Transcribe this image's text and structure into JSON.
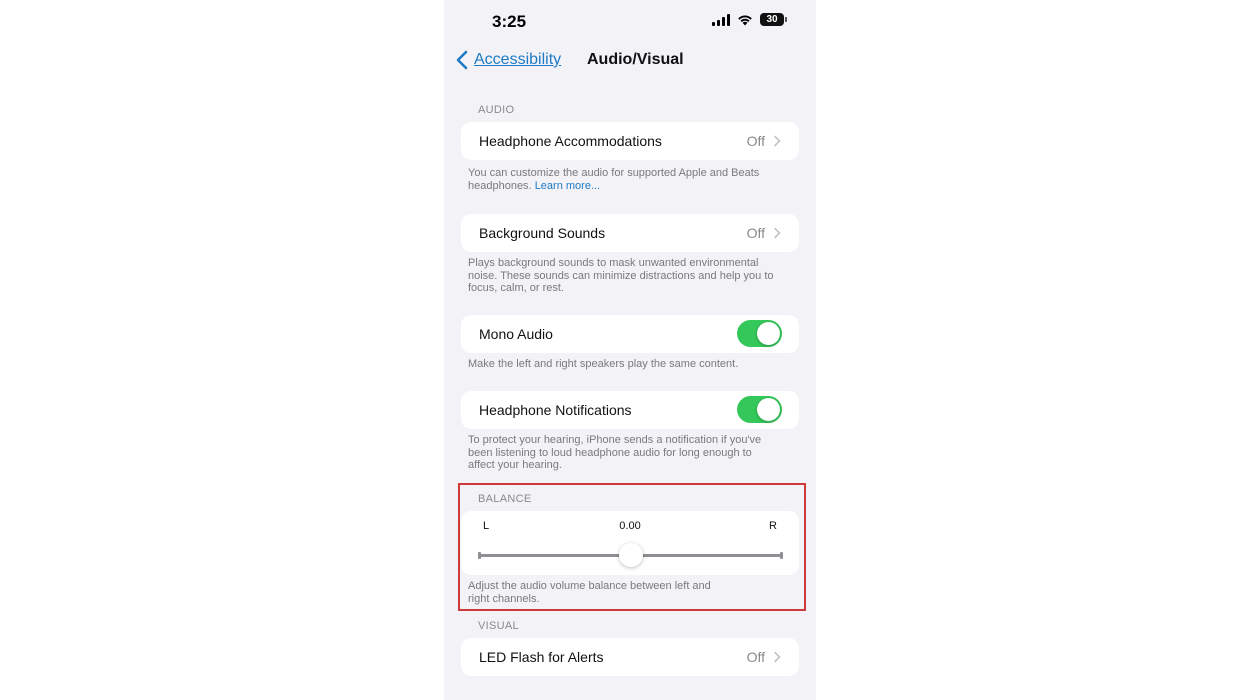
{
  "status_bar": {
    "time": "3:25",
    "battery_level": "30",
    "icons": [
      "cellular-signal-icon",
      "wifi-icon",
      "battery-icon"
    ]
  },
  "nav": {
    "back_label": "Accessibility",
    "title": "Audio/Visual"
  },
  "colors": {
    "accent": "#1f7bc4",
    "toggle_on": "#34c759",
    "background": "#f2f2f7",
    "highlight": "#d0393c"
  },
  "sections": {
    "audio": {
      "header": "AUDIO",
      "headphone_accommodations": {
        "label": "Headphone Accommodations",
        "value": "Off",
        "footer": "You can customize the audio for supported Apple and Beats headphones.",
        "footer_link": "Learn more..."
      },
      "background_sounds": {
        "label": "Background Sounds",
        "value": "Off",
        "footer": "Plays background sounds to mask unwanted environmental noise. These sounds can minimize distractions and help you to focus, calm, or rest."
      },
      "mono_audio": {
        "label": "Mono Audio",
        "enabled": true,
        "footer": "Make the left and right speakers play the same content."
      },
      "headphone_notifications": {
        "label": "Headphone Notifications",
        "enabled": true,
        "footer": "To protect your hearing, iPhone sends a notification if you've been listening to loud headphone audio for long enough to affect your hearing."
      }
    },
    "balance": {
      "header": "BALANCE",
      "left_label": "L",
      "right_label": "R",
      "value_text": "0.00",
      "value": 0.0,
      "min": -1.0,
      "max": 1.0,
      "footer": "Adjust the audio volume balance between left and right channels."
    },
    "visual": {
      "header": "VISUAL",
      "led_flash": {
        "label": "LED Flash for Alerts",
        "value": "Off"
      }
    }
  }
}
